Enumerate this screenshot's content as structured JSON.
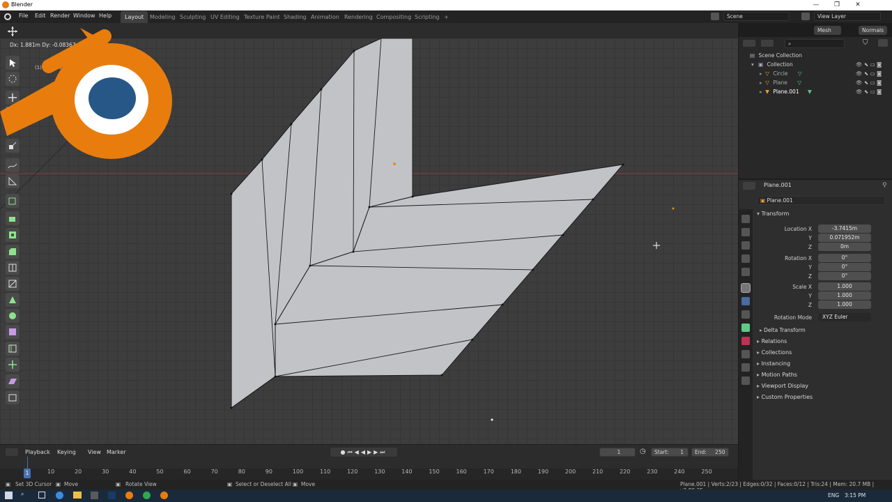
{
  "window": {
    "title": "Blender",
    "min_icon": "minimize-icon",
    "max_icon": "maximize-icon",
    "close_icon": "close-icon"
  },
  "menu": [
    "File",
    "Edit",
    "Render",
    "Window",
    "Help"
  ],
  "workspaces": [
    "Layout",
    "Modeling",
    "Sculpting",
    "UV Editing",
    "Texture Paint",
    "Shading",
    "Animation",
    "Rendering",
    "Compositing",
    "Scripting"
  ],
  "scene": {
    "label": "Scene",
    "view_layer": "View Layer"
  },
  "viewport_header": {
    "mesh_options": "Mesh Options",
    "normals": "Normals"
  },
  "viewport": {
    "op_info": "Dx: 1.881m  Dy: -0.08367m  Dz: -0m",
    "obj_label": "(1) Plane.001"
  },
  "outliner": {
    "root": "Scene Collection",
    "collection": "Collection",
    "items": [
      "Circle",
      "Plane",
      "Plane.001"
    ]
  },
  "properties": {
    "object_name": "Plane.001",
    "object_field": "Plane.001",
    "transform_header": "Transform",
    "location_label": "Location X",
    "location": [
      "-3.7415m",
      "0.071952m",
      "0m"
    ],
    "rotation_label": "Rotation X",
    "rotation": [
      "0°",
      "0°",
      "0°"
    ],
    "scale_label": "Scale X",
    "scale": [
      "1.000",
      "1.000",
      "1.000"
    ],
    "axis_y": "Y",
    "axis_z": "Z",
    "rotation_mode_label": "Rotation Mode",
    "rotation_mode": "XYZ Euler",
    "delta": "Delta Transform",
    "panels": [
      "Relations",
      "Collections",
      "Instancing",
      "Motion Paths",
      "Viewport Display",
      "Custom Properties"
    ]
  },
  "timeline": {
    "menus": [
      "Playback",
      "Keying",
      "View",
      "Marker"
    ],
    "current_frame": "1",
    "start_label": "Start:",
    "start": "1",
    "end_label": "End:",
    "end": "250",
    "ruler": [
      "10",
      "20",
      "30",
      "40",
      "50",
      "60",
      "70",
      "80",
      "90",
      "100",
      "110",
      "120",
      "130",
      "140",
      "150",
      "160",
      "170",
      "180",
      "190",
      "200",
      "210",
      "220",
      "230",
      "240",
      "250"
    ],
    "ruler_current": "1"
  },
  "status": {
    "left": [
      "Set 3D Cursor",
      "Move",
      "Rotate View",
      "Select or Deselect All",
      "Move"
    ],
    "right": "Plane.001 | Verts:2/23 | Edges:0/32 | Faces:0/12 | Tris:24 | Mem: 20.7 MB | v2.80.35"
  },
  "taskbar": {
    "lang": "ENG",
    "time": "3:15 PM"
  },
  "colors": {
    "accent": "#5680c2",
    "logo_orange": "#e87d0d",
    "logo_blue": "#265787",
    "mesh": "#c2c3c7"
  }
}
